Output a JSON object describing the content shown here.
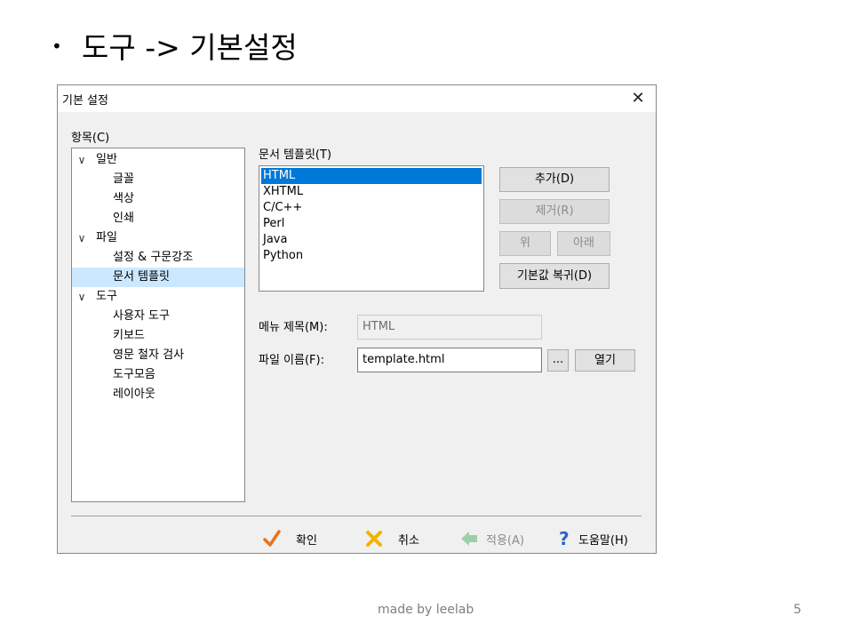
{
  "slide": {
    "bullet": "•",
    "title": "도구 -> 기본설정",
    "footer": "made by leelab",
    "page_number": "5"
  },
  "dialog": {
    "title": "기본 설정",
    "close_glyph": "✕",
    "category_label": "항목(C)",
    "tree": [
      {
        "label": "일반",
        "level": 0,
        "expanded": true,
        "selected": false
      },
      {
        "label": "글꼴",
        "level": 1,
        "selected": false
      },
      {
        "label": "색상",
        "level": 1,
        "selected": false
      },
      {
        "label": "인쇄",
        "level": 1,
        "selected": false
      },
      {
        "label": "파일",
        "level": 0,
        "expanded": true,
        "selected": false
      },
      {
        "label": "설정 & 구문강조",
        "level": 1,
        "selected": false
      },
      {
        "label": "문서 템플릿",
        "level": 1,
        "selected": true
      },
      {
        "label": "도구",
        "level": 0,
        "expanded": true,
        "selected": false
      },
      {
        "label": "사용자 도구",
        "level": 1,
        "selected": false
      },
      {
        "label": "키보드",
        "level": 1,
        "selected": false
      },
      {
        "label": "영문 철자 검사",
        "level": 1,
        "selected": false
      },
      {
        "label": "도구모음",
        "level": 1,
        "selected": false
      },
      {
        "label": "레이아웃",
        "level": 1,
        "selected": false
      }
    ],
    "template_list_label": "문서 템플릿(T)",
    "templates": [
      {
        "label": "HTML",
        "selected": true
      },
      {
        "label": "XHTML",
        "selected": false
      },
      {
        "label": "C/C++",
        "selected": false
      },
      {
        "label": "Perl",
        "selected": false
      },
      {
        "label": "Java",
        "selected": false
      },
      {
        "label": "Python",
        "selected": false
      }
    ],
    "buttons": {
      "add": "추가(D)",
      "remove": "제거(R)",
      "up": "위",
      "down": "아래",
      "restore_default": "기본값 복귀(D)",
      "browse": "...",
      "open": "열기"
    },
    "menu_title_label": "메뉴 제목(M):",
    "menu_title_value": "HTML",
    "file_name_label": "파일 이름(F):",
    "file_name_value": "template.html",
    "bottom": {
      "ok": "확인",
      "cancel": "취소",
      "apply": "적용(A)",
      "help": "도움말(H)"
    },
    "colors": {
      "ok_icon": "#e8731a",
      "cancel_icon": "#f0b400",
      "apply_icon": "#9ccfa8",
      "help_icon": "#2a64c8",
      "selection": "#0078d7",
      "tree_selection": "#cce8ff"
    }
  }
}
